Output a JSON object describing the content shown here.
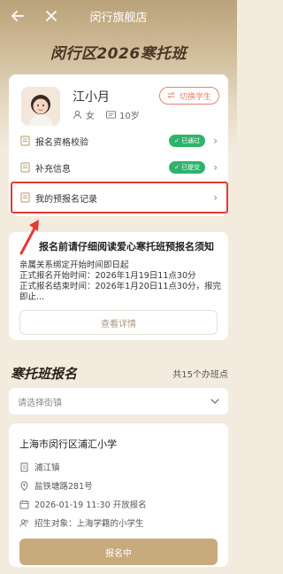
{
  "nav": {
    "title": "闵行旗舰店",
    "back_icon": "arrow-left-icon",
    "close_icon": "close-icon"
  },
  "banner": {
    "title": "闵行区2026寒托班"
  },
  "student": {
    "name": "江小月",
    "gender": "女",
    "age": "10岁",
    "switch_label": "切换学生"
  },
  "menu": [
    {
      "label": "报名资格校验",
      "status": "已通过",
      "status_color": "#2fb36b"
    },
    {
      "label": "补充信息",
      "status": "已提交",
      "status_color": "#2fb36b"
    },
    {
      "label": "我的预报名记录"
    }
  ],
  "notice": {
    "title": "报名前请仔细阅读爱心寒托班预报名须知",
    "lines": [
      "亲属关系绑定开始时间即日起",
      "正式报名开始时间：2026年1月19日11点30分",
      "正式报名结束时间：2026年1月20日11点30分，报完",
      "即止..."
    ],
    "detail_button": "查看详情"
  },
  "section": {
    "title": "寒托班报名",
    "count": "共15个办班点"
  },
  "street_select": {
    "placeholder": "请选择街镇"
  },
  "school": {
    "name": "上海市闵行区浦汇小学",
    "town": "浦江镇",
    "address": "盐铁塘路281号",
    "open_time": "2026-01-19 11:30 开放报名",
    "target": "招生对象：上海学籍的小学生",
    "button": "报名中"
  },
  "colors": {
    "accent": "#c8ab7d",
    "success": "#2fb36b",
    "switch": "#e9836c",
    "highlight": "#e53935"
  }
}
